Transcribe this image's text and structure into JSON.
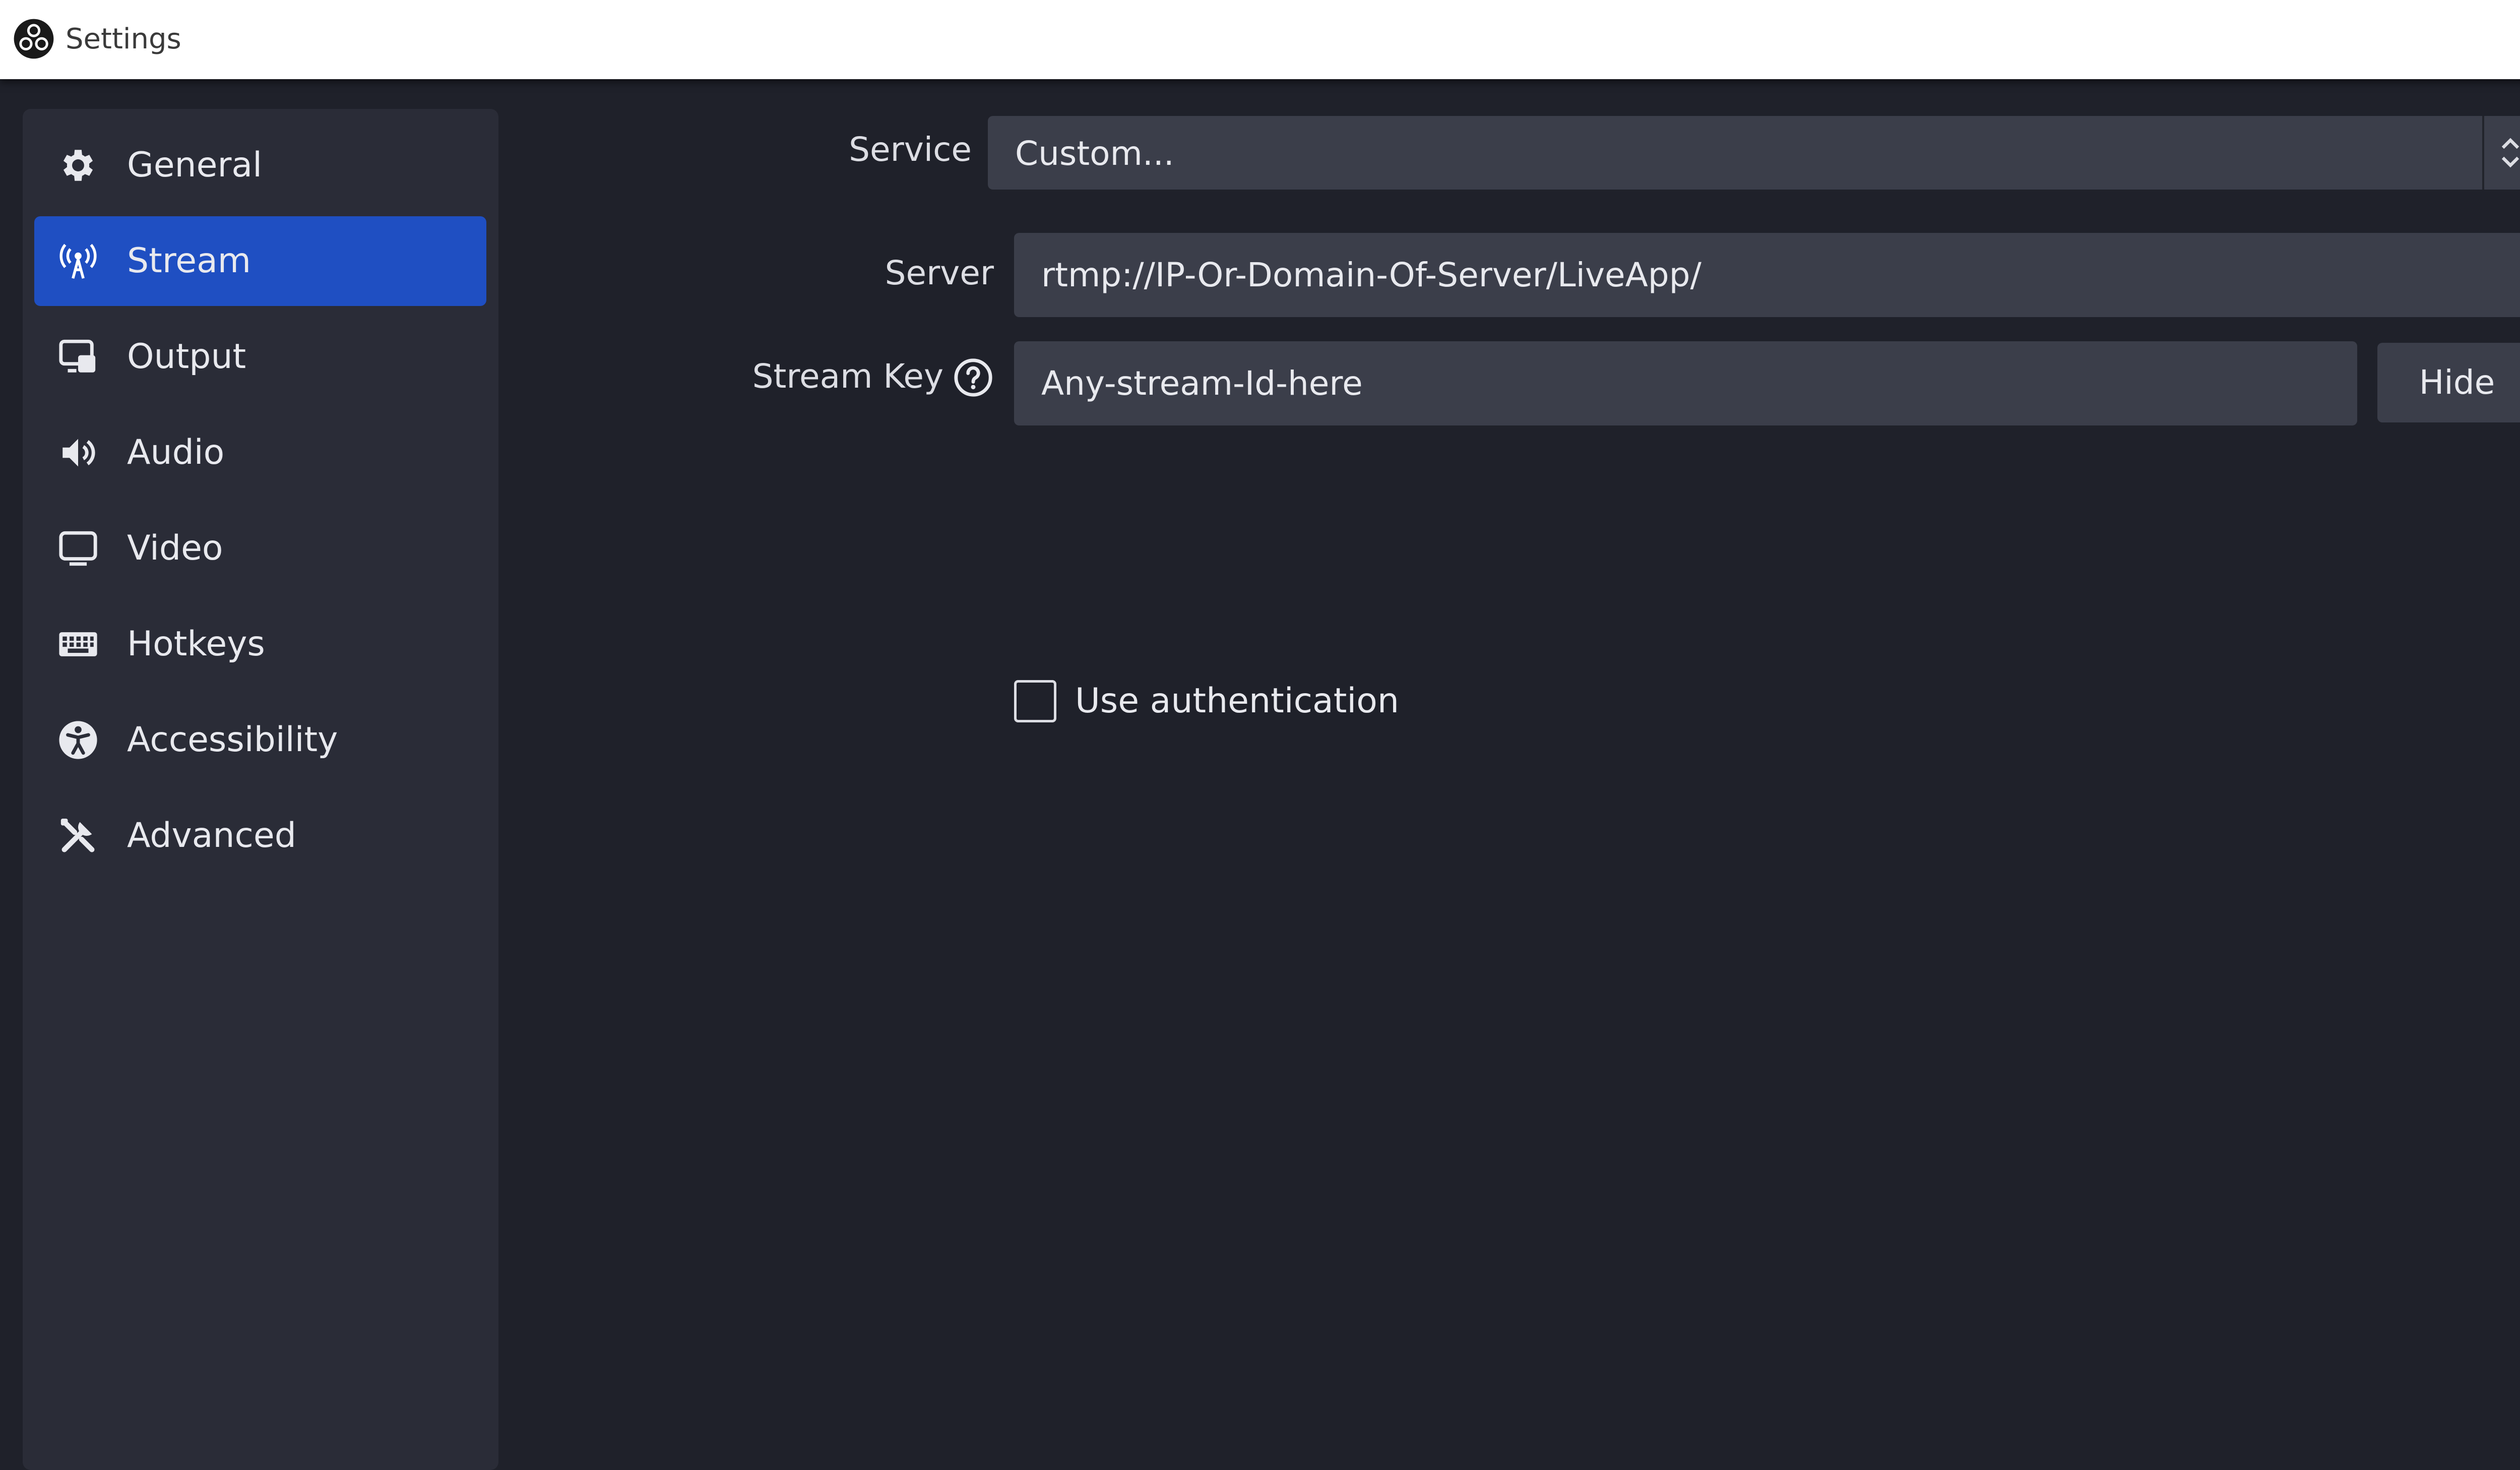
{
  "window": {
    "title": "Settings",
    "app_icon": "obs-logo-icon",
    "close_icon": "close-icon"
  },
  "sidebar": {
    "items": [
      {
        "label": "General",
        "icon": "gear-icon",
        "active": false
      },
      {
        "label": "Stream",
        "icon": "antenna-icon",
        "active": true
      },
      {
        "label": "Output",
        "icon": "output-icon",
        "active": false
      },
      {
        "label": "Audio",
        "icon": "speaker-icon",
        "active": false
      },
      {
        "label": "Video",
        "icon": "monitor-icon",
        "active": false
      },
      {
        "label": "Hotkeys",
        "icon": "keyboard-icon",
        "active": false
      },
      {
        "label": "Accessibility",
        "icon": "accessibility-icon",
        "active": false
      },
      {
        "label": "Advanced",
        "icon": "tools-icon",
        "active": false
      }
    ]
  },
  "stream": {
    "service_label": "Service",
    "service_value": "Custom...",
    "server_label": "Server",
    "server_value": "rtmp://IP-Or-Domain-Of-Server/LiveApp/",
    "stream_key_label": "Stream Key",
    "stream_key_value": "Any-stream-Id-here",
    "hide_button": "Hide",
    "use_auth_label": "Use authentication",
    "use_auth_checked": false
  },
  "colors": {
    "background": "#1f212a",
    "sidebar": "#2a2c37",
    "active_accent": "#1f4fc2",
    "input_bg": "#3b3e4a",
    "text": "#e8e9ee"
  }
}
